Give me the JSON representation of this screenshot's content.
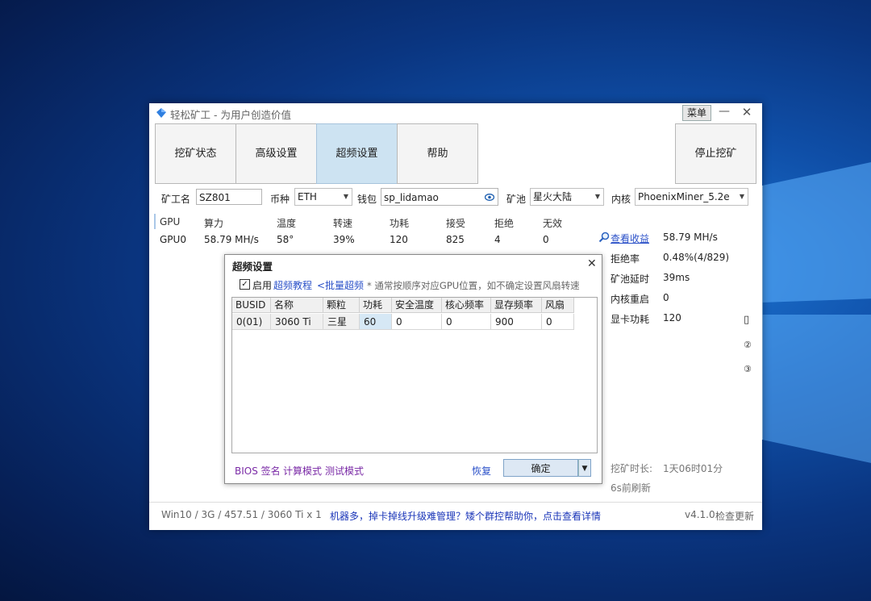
{
  "app": {
    "title": "轻松矿工 - 为用户创造价值",
    "menu_label": "菜单",
    "minimize_label": "—",
    "close_label": "✕"
  },
  "tabs": [
    {
      "label": "挖矿状态"
    },
    {
      "label": "高级设置"
    },
    {
      "label": "超频设置"
    },
    {
      "label": "帮助"
    }
  ],
  "active_tab": "超频设置",
  "stop_button_label": "停止挖矿",
  "config": {
    "worker_label": "矿工名",
    "worker_value": "SZ801",
    "coin_label": "币种",
    "coin_value": "ETH",
    "wallet_label": "钱包",
    "wallet_value": "sp_lidamao",
    "pool_label": "矿池",
    "pool_value": "星火大陆",
    "kernel_label": "内核",
    "kernel_value": "PhoenixMiner_5.2e"
  },
  "gpu_table": {
    "headers": [
      "GPU",
      "算力",
      "温度",
      "转速",
      "功耗",
      "接受",
      "拒绝",
      "无效"
    ],
    "rows": [
      [
        "GPU0",
        "58.79 MH/s",
        "58°",
        "39%",
        "120",
        "825",
        "4",
        "0"
      ]
    ]
  },
  "stats": {
    "view_earnings_link": "查看收益",
    "hashrate": "58.79 MH/s",
    "reject_rate_label": "拒绝率",
    "reject_rate_value": "0.48%(4/829)",
    "pool_latency_label": "矿池延时",
    "pool_latency_value": "39ms",
    "kernel_restart_label": "内核重启",
    "kernel_restart_value": "0",
    "gpu_power_label": "显卡功耗",
    "gpu_power_value": "120",
    "side_icons": [
      "▯",
      "②",
      "③"
    ],
    "mining_time_label": "挖矿时长:",
    "mining_time_value": "1天06时01分",
    "refresh_text": "6s前刷新"
  },
  "status_bar": {
    "system_info": "Win10  / 3G / 457.51 / 3060 Ti x 1",
    "promo_text": "机器多，掉卡掉线升级难管理？矮个群控帮助你，点击查看详情",
    "version": "v4.1.0",
    "check_update": "检查更新"
  },
  "oc_dialog": {
    "title": "超频设置",
    "close_label": "✕",
    "enable_label": "启用",
    "enable_checked": true,
    "tutorial_link": "超频教程",
    "batch_link": "<批量超频",
    "note": "* 通常按顺序对应GPU位置，如不确定设置风扇转速",
    "columns": [
      "BUSID",
      "名称",
      "颗粒",
      "功耗",
      "安全温度",
      "核心频率",
      "显存频率",
      "风扇"
    ],
    "rows": [
      [
        "0(01)",
        "3060 Ti",
        "三星",
        "60",
        "0",
        "0",
        "900",
        "0"
      ]
    ],
    "bios_links": [
      "BIOS 签名",
      "计算模式",
      "测试模式"
    ],
    "restore_label": "恢复",
    "confirm_label": "确定",
    "dropdown_arrow": "▼"
  },
  "colors": {
    "active_tab_bg": "#cde3f2",
    "link_blue": "#2a50c8",
    "bios_purple": "#7a2aa6",
    "promo_blue": "#1a35b8"
  }
}
